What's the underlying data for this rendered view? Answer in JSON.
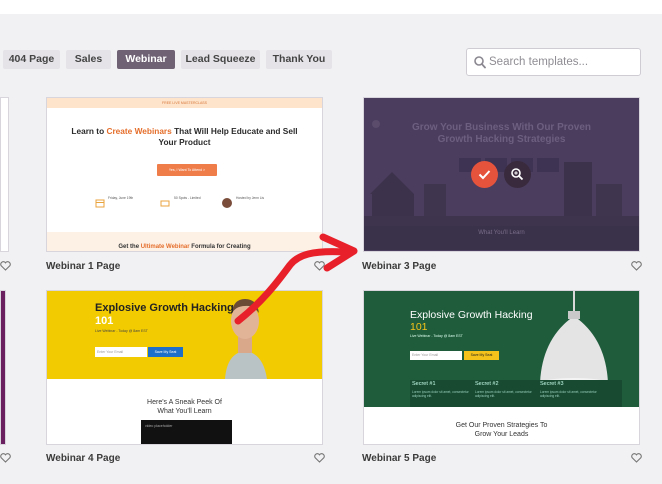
{
  "filter_tabs": [
    {
      "label": "404 Page"
    },
    {
      "label": "Sales"
    },
    {
      "label": "Webinar"
    },
    {
      "label": "Lead Squeeze"
    },
    {
      "label": "Thank You"
    }
  ],
  "search": {
    "placeholder": "Search templates..."
  },
  "templates": [
    {
      "name": "Webinar 1 Page",
      "top_banner": "FREE LIVE MASTERCLASS",
      "headline_pre": "Learn to ",
      "headline_highlight": "Create Webinars",
      "headline_post": " That Will Help Educate and Sell Your Product",
      "cta": "Yes, I Want To Attend >",
      "features": [
        "Friday, June 19th",
        "50 Spots - Limited",
        "Hosted by Jenn Lis"
      ],
      "bottom_pre": "Get the ",
      "bottom_highlight": "Ultimate Webinar",
      "bottom_post": " Formula for Creating"
    },
    {
      "name": "Webinar 3 Page",
      "headline": "Grow Your Business With Our Proven Growth Hacking Strategies",
      "bottom": "What You'll Learn"
    },
    {
      "name": "Webinar 4 Page",
      "headline": "Explosive Growth Hacking ",
      "headline_highlight": "101",
      "sub": "Live Webinar - Today @ 8am EST",
      "input_placeholder": "Enter Your Email",
      "cta": "Save My Seat",
      "sneak": "Here's A Sneak Peek Of What You'll Learn",
      "video": "video placeholder"
    },
    {
      "name": "Webinar 5 Page",
      "headline": "Explosive Growth Hacking ",
      "headline_highlight": "101",
      "sub": "Live Webinar - Today @ 8am EST",
      "input_placeholder": "Enter Your Email",
      "cta": "Save My Seat",
      "secrets": [
        "Secret #1",
        "Secret #2",
        "Secret #3"
      ],
      "secret_text": "Lorem ipsum dolor sit amet, consectetur adipiscing elit.",
      "bottom": "Get Our Proven Strategies To Grow Your Leads"
    }
  ],
  "colors": {
    "active_tab": "#6f6274",
    "annotation_arrow": "#e8202a",
    "check_button": "#e5533c"
  },
  "icons": [
    "search-icon",
    "heart-icon",
    "check-icon",
    "zoom-icon"
  ]
}
